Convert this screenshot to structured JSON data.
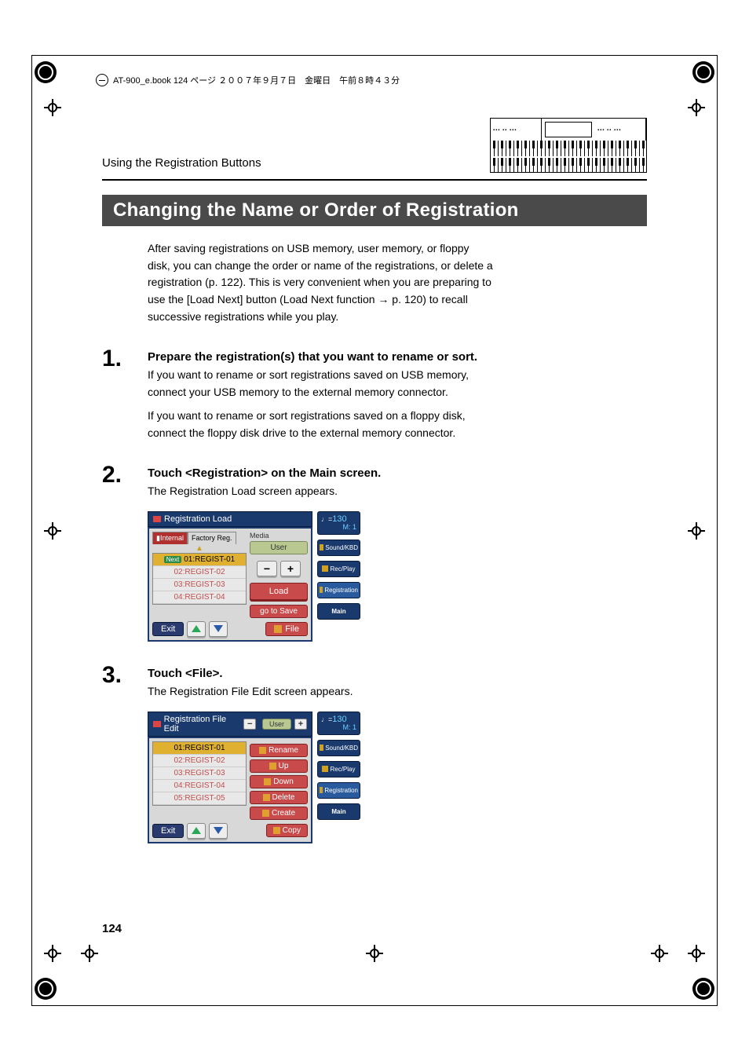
{
  "bookinfo": "AT-900_e.book  124 ページ  ２００７年９月７日　金曜日　午前８時４３分",
  "chapter": "Using the Registration Buttons",
  "section_title": "Changing the Name or Order of Registration",
  "intro": "After saving registrations on USB memory, user memory, or floppy disk, you can change the order or name of the registrations, or delete a registration (p. 122). This is very convenient when you are preparing to use the [Load Next] button (Load Next function → p. 120) to recall successive registrations while you play.",
  "steps": {
    "s1": {
      "num": "1.",
      "title": "Prepare the registration(s) that you want to rename or sort.",
      "text1": "If you want to rename or sort registrations saved on USB memory, connect your USB memory to the external memory connector.",
      "text2": "If you want to rename or sort registrations saved on a floppy disk, connect the floppy disk drive to the external memory connector."
    },
    "s2": {
      "num": "2.",
      "title": "Touch <Registration> on the Main screen.",
      "text": "The Registration Load screen appears."
    },
    "s3": {
      "num": "3.",
      "title": "Touch <File>.",
      "text": "The Registration File Edit screen appears."
    }
  },
  "ui1": {
    "title": "Registration Load",
    "tabs": {
      "internal": "Internal",
      "factory": "Factory Reg."
    },
    "items": [
      "01:REGIST-01",
      "02:REGIST-02",
      "03:REGIST-03",
      "04:REGIST-04"
    ],
    "next_tag": "Next",
    "media": "Media",
    "user": "User",
    "load": "Load",
    "go_to_save": "go to Save",
    "exit": "Exit",
    "file": "File"
  },
  "ui2": {
    "title": "Registration File Edit",
    "user": "User",
    "items": [
      "01:REGIST-01",
      "02:REGIST-02",
      "03:REGIST-03",
      "04:REGIST-04",
      "05:REGIST-05"
    ],
    "actions": {
      "rename": "Rename",
      "up": "Up",
      "down": "Down",
      "delete": "Delete",
      "create": "Create",
      "copy": "Copy"
    },
    "exit": "Exit"
  },
  "side": {
    "tempo_val": "130",
    "tempo_m": "M:      1",
    "sound": "Sound/KBD",
    "recplay": "Rec/Play",
    "registration": "Registration",
    "main": "Main"
  },
  "page_num": "124"
}
